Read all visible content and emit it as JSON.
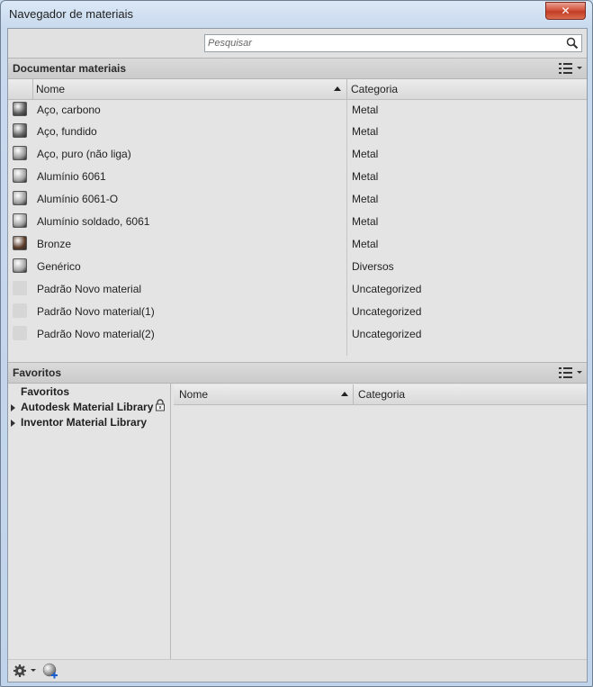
{
  "window": {
    "title": "Navegador de materiais",
    "close_glyph": "✕"
  },
  "search": {
    "placeholder": "Pesquisar",
    "value": "",
    "icon": "magnifier-icon"
  },
  "document_section": {
    "title": "Documentar materiais",
    "view_icon": "list-view-icon",
    "columns": {
      "name": "Nome",
      "category": "Categoria"
    },
    "sort": "ascending",
    "rows": [
      {
        "name": "Aço, carbono",
        "category": "Metal",
        "swatch": "#5a5a5a"
      },
      {
        "name": "Aço, fundido",
        "category": "Metal",
        "swatch": "#666666"
      },
      {
        "name": "Aço, puro (não liga)",
        "category": "Metal",
        "swatch": "#9a9a9a"
      },
      {
        "name": "Alumínio 6061",
        "category": "Metal",
        "swatch": "#a6a6a6"
      },
      {
        "name": "Alumínio 6061-O",
        "category": "Metal",
        "swatch": "#a0a0a0"
      },
      {
        "name": "Alumínio soldado, 6061",
        "category": "Metal",
        "swatch": "#a3a3a3"
      },
      {
        "name": "Bronze",
        "category": "Metal",
        "swatch": "#5b3b28"
      },
      {
        "name": "Genérico",
        "category": "Diversos",
        "swatch": "#a8a8a8"
      },
      {
        "name": "Padrão Novo material",
        "category": "Uncategorized",
        "swatch": "#d6d6d6"
      },
      {
        "name": "Padrão Novo material(1)",
        "category": "Uncategorized",
        "swatch": "#d6d6d6"
      },
      {
        "name": "Padrão Novo material(2)",
        "category": "Uncategorized",
        "swatch": "#d6d6d6"
      }
    ]
  },
  "favorites_section": {
    "title": "Favoritos",
    "view_icon": "list-view-icon",
    "tree": [
      {
        "label": "Favoritos",
        "expandable": false,
        "locked": false
      },
      {
        "label": "Autodesk Material Library",
        "expandable": true,
        "locked": true
      },
      {
        "label": "Inventor Material Library",
        "expandable": true,
        "locked": false
      }
    ],
    "columns": {
      "name": "Nome",
      "category": "Categoria"
    }
  },
  "bottom_bar": {
    "settings_icon": "gear-icon",
    "new_material_icon": "new-material-icon"
  }
}
